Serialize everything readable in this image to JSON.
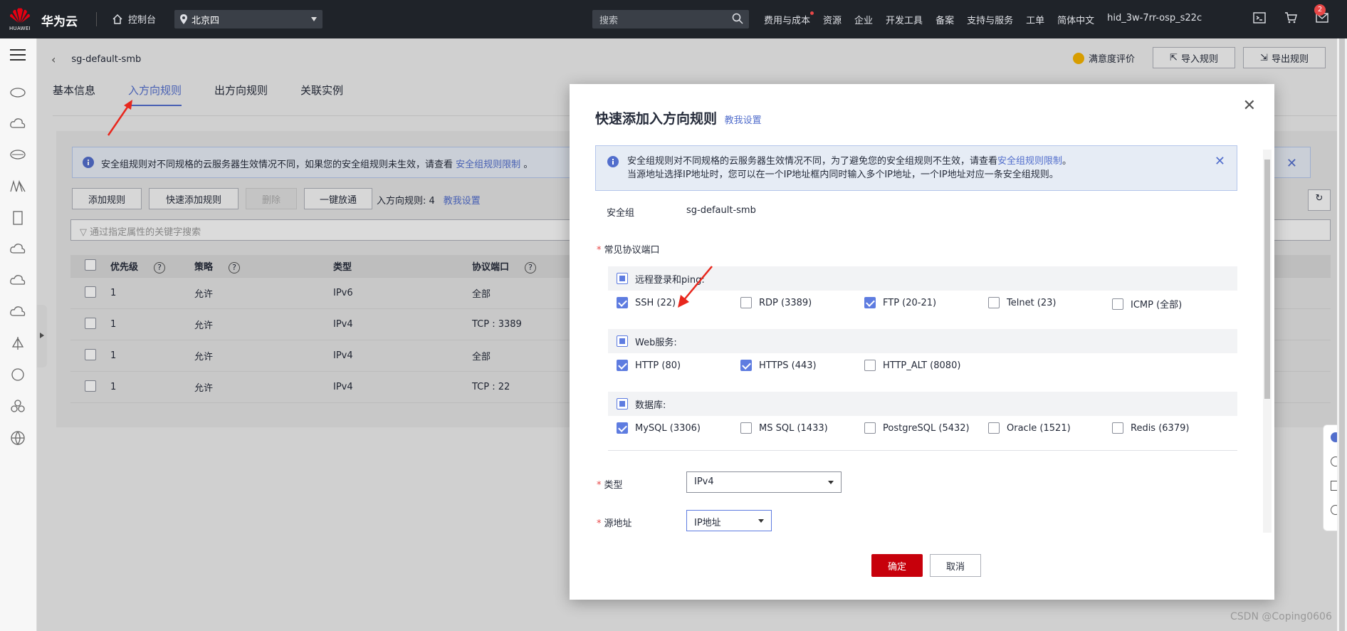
{
  "topbar": {
    "logo_text": "HUAWEI",
    "brand": "华为云",
    "console": "控制台",
    "region": "北京四",
    "search_placeholder": "搜索",
    "nav": [
      "费用与成本",
      "资源",
      "企业",
      "开发工具",
      "备案",
      "支持与服务",
      "工单",
      "简体中文",
      "hid_3w-7rr-osp_s22c"
    ],
    "message_count": "2"
  },
  "page": {
    "breadcrumb": "sg-default-smb",
    "satisfaction": "满意度评价",
    "import_label": "导入规则",
    "export_label": "导出规则",
    "tabs": [
      "基本信息",
      "入方向规则",
      "出方向规则",
      "关联实例"
    ],
    "active_tab": "入方向规则"
  },
  "panel": {
    "notice_text": "安全组规则对不同规格的云服务器生效情况不同，如果您的安全组规则未生效，请查看",
    "notice_link": "安全组规则限制",
    "notice_tail": "。",
    "buttons": [
      "添加规则",
      "快速添加规则",
      "删除",
      "一键放通"
    ],
    "rule_count_label": "入方向规则: 4",
    "help_link": "教我设置",
    "filter_placeholder": "通过指定属性的关键字搜索",
    "columns": [
      "优先级",
      "策略",
      "类型",
      "协议端口"
    ],
    "rows": [
      {
        "priority": "1",
        "policy": "允许",
        "type": "IPv6",
        "port": "全部"
      },
      {
        "priority": "1",
        "policy": "允许",
        "type": "IPv4",
        "port": "TCP : 3389"
      },
      {
        "priority": "1",
        "policy": "允许",
        "type": "IPv4",
        "port": "全部"
      },
      {
        "priority": "1",
        "policy": "允许",
        "type": "IPv4",
        "port": "TCP : 22"
      }
    ]
  },
  "modal": {
    "title": "快速添加入方向规则",
    "title_link": "教我设置",
    "notice_line1": "安全组规则对不同规格的云服务器生效情况不同，为了避免您的安全组规则不生效，请查看",
    "notice_link": "安全组规则限制",
    "notice_line1_tail": "。",
    "notice_line2": "当源地址选择IP地址时，您可以在一个IP地址框内同时输入多个IP地址，一个IP地址对应一条安全组规则。",
    "sg_label": "安全组",
    "sg_value": "sg-default-smb",
    "ports_label": "常见协议端口",
    "groups": [
      {
        "title": "远程登录和ping:",
        "options": [
          {
            "label": "SSH (22)",
            "checked": true
          },
          {
            "label": "RDP (3389)",
            "checked": false
          },
          {
            "label": "FTP (20-21)",
            "checked": true
          },
          {
            "label": "Telnet (23)",
            "checked": false
          },
          {
            "label": "ICMP (全部)",
            "checked": false
          }
        ]
      },
      {
        "title": "Web服务:",
        "options": [
          {
            "label": "HTTP (80)",
            "checked": true
          },
          {
            "label": "HTTPS (443)",
            "checked": true
          },
          {
            "label": "HTTP_ALT (8080)",
            "checked": false
          }
        ]
      },
      {
        "title": "数据库:",
        "options": [
          {
            "label": "MySQL (3306)",
            "checked": true
          },
          {
            "label": "MS SQL (1433)",
            "checked": false
          },
          {
            "label": "PostgreSQL (5432)",
            "checked": false
          },
          {
            "label": "Oracle (1521)",
            "checked": false
          },
          {
            "label": "Redis (6379)",
            "checked": false
          }
        ]
      }
    ],
    "type_label": "类型",
    "type_value": "IPv4",
    "source_label": "源地址",
    "source_value": "IP地址",
    "ok_label": "确定",
    "cancel_label": "取消"
  },
  "watermark": "CSDN @Coping0606",
  "colors": {
    "accent": "#526ecc",
    "primary_button": "#c7000b",
    "annotation_arrow": "#e8271d"
  }
}
